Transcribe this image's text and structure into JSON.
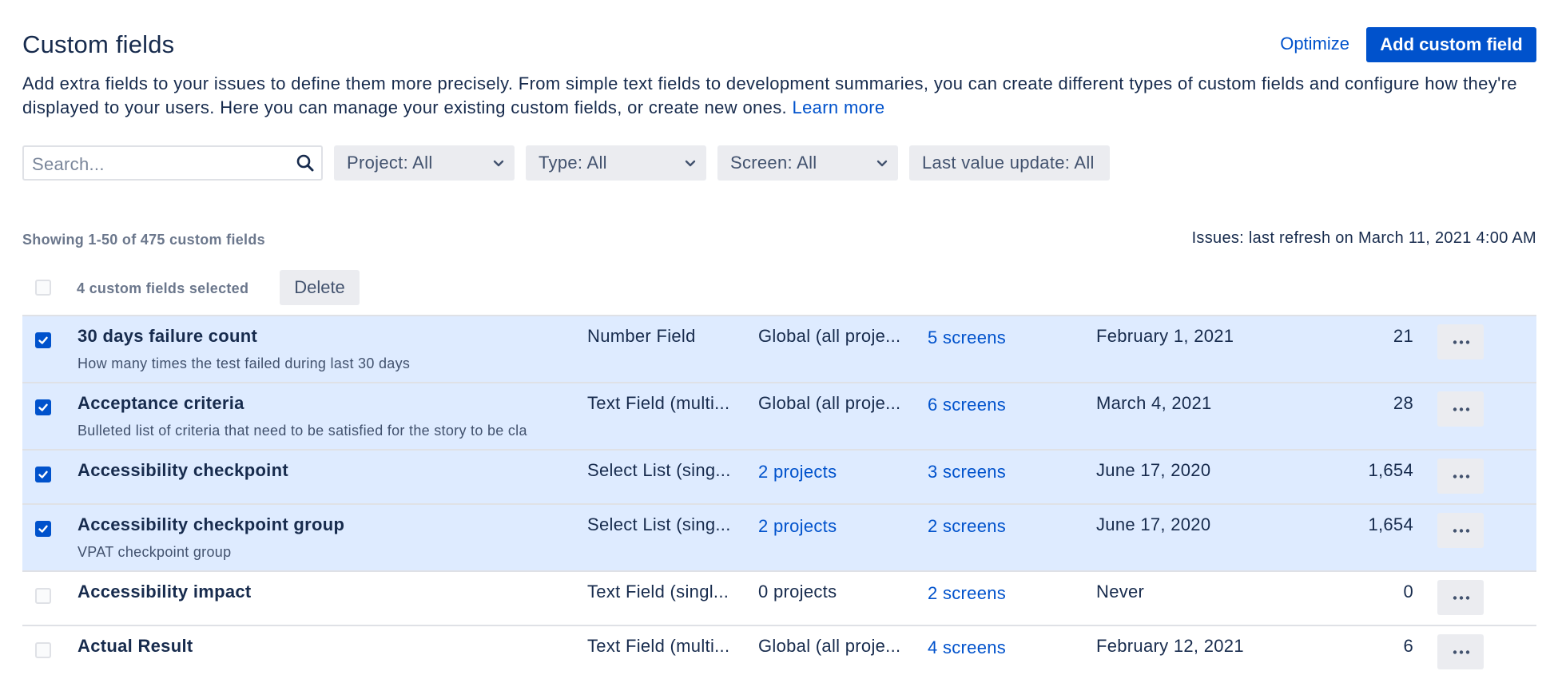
{
  "header": {
    "title": "Custom fields",
    "optimize_label": "Optimize",
    "add_button_label": "Add custom field"
  },
  "description": {
    "text": "Add extra fields to your issues to define them more precisely. From simple text fields to development summaries, you can create different types of custom fields and configure how they're displayed to your users. Here you can manage your existing custom fields, or create new ones.",
    "link_label": "Learn more"
  },
  "filters": {
    "search_placeholder": "Search...",
    "project": "Project: All",
    "type": "Type: All",
    "screen": "Screen: All",
    "last_value_update": "Last value update: All"
  },
  "summary": {
    "showing": "Showing 1-50 of 475 custom fields",
    "refresh": "Issues: last refresh on March 11, 2021 4:00 AM"
  },
  "selection": {
    "count_label": "4 custom fields selected",
    "delete_label": "Delete"
  },
  "rows": [
    {
      "name": "30 days failure count",
      "description": "How many times the test failed during last 30 days",
      "type": "Number Field",
      "context": "Global (all proje...",
      "context_link": false,
      "screens": "5 screens",
      "date": "February 1, 2021",
      "count": "21",
      "selected": true
    },
    {
      "name": "Acceptance criteria",
      "description": "Bulleted list of criteria that need to be satisfied for the story to be cla",
      "type": "Text Field (multi...",
      "context": "Global (all proje...",
      "context_link": false,
      "screens": "6 screens",
      "date": "March 4, 2021",
      "count": "28",
      "selected": true
    },
    {
      "name": "Accessibility checkpoint",
      "description": "",
      "type": "Select List (sing...",
      "context": "2 projects",
      "context_link": true,
      "screens": "3 screens",
      "date": "June 17, 2020",
      "count": "1,654",
      "selected": true
    },
    {
      "name": "Accessibility checkpoint group",
      "description": "VPAT checkpoint group",
      "type": "Select List (sing...",
      "context": "2 projects",
      "context_link": true,
      "screens": "2 screens",
      "date": "June 17, 2020",
      "count": "1,654",
      "selected": true
    },
    {
      "name": "Accessibility impact",
      "description": "",
      "type": "Text Field (singl...",
      "context": "0 projects",
      "context_link": false,
      "screens": "2 screens",
      "date": "Never",
      "count": "0",
      "selected": false
    },
    {
      "name": "Actual Result",
      "description": "",
      "type": "Text Field (multi...",
      "context": "Global (all proje...",
      "context_link": false,
      "screens": "4 screens",
      "date": "February 12, 2021",
      "count": "6",
      "selected": false
    }
  ]
}
